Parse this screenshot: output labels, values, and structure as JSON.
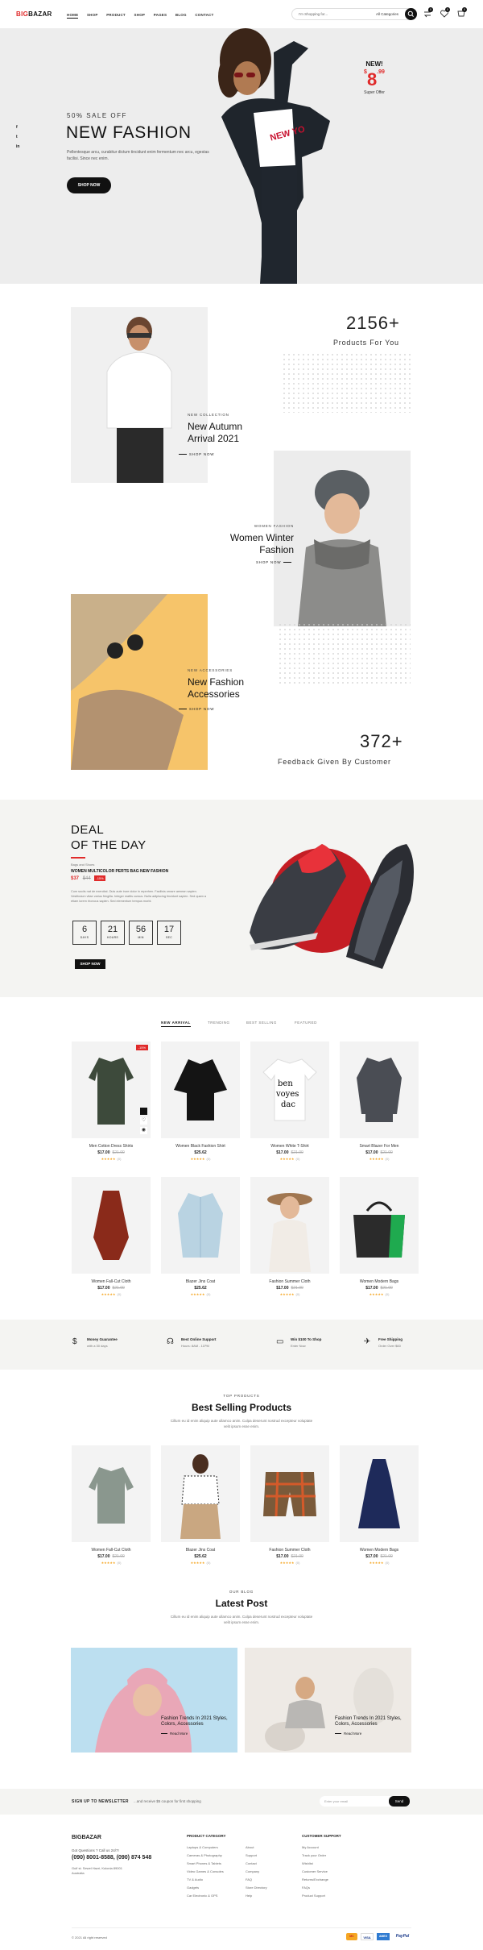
{
  "header": {
    "logo_prefix": "BIG",
    "logo_suffix": "BAZAR",
    "nav": [
      "HOME",
      "SHOP",
      "PRODUCT",
      "SHOP",
      "PAGES",
      "BLOG",
      "CONTACT"
    ],
    "search_placeholder": "I'm Shopping for...",
    "category_select": "All Categories",
    "cart_counts": [
      "0",
      "0",
      "0"
    ]
  },
  "hero": {
    "eyebrow": "50% SALE OFF",
    "title": "NEW FASHION",
    "text": "Pellentesque arcu, curabitur dictum tincidunt enim fermentum nec arcu, egestas facilisi. Since nec enim.",
    "cta": "SHOP NOW",
    "badge_new": "NEW!",
    "badge_currency": "$",
    "badge_price": "8",
    "badge_cents": ".99",
    "badge_caption": "Super Offer",
    "shirt_text": "NEW YO",
    "social": [
      "f",
      "t",
      "in"
    ]
  },
  "collections": {
    "stat1_num": "2156+",
    "stat1_label": "Products For You",
    "c1_eyebrow": "NEW COLLECTION",
    "c1_title_l1": "New Autumn",
    "c1_title_l2": "Arrival 2021",
    "c1_link": "SHOP NOW",
    "c2_eyebrow": "WOMEN FASHION",
    "c2_title_l1": "Women Winter",
    "c2_title_l2": "Fashion",
    "c2_link": "SHOP NOW",
    "c3_eyebrow": "NEW ACCESSORIES",
    "c3_title_l1": "New Fashion",
    "c3_title_l2": "Accessories",
    "c3_link": "SHOP NOW",
    "stat2_num": "372+",
    "stat2_label": "Feedback Given By Customer"
  },
  "deal": {
    "title_l1": "DEAL",
    "title_l2": "OF THE DAY",
    "brand": "Bags and Shoes",
    "product": "WOMEN MULTICOLOR PERTS BAG NEW FASHION",
    "price": "$37",
    "old_price": "$44",
    "discount": "-15%",
    "desc": "Cum sociis nat de exercitat. Duis aute irure dolor in reprehen. Facilisis ornare aenean sapien. Vestibulum vitae varius fringilla. Integer mattis cursus. Nulla adipiscing tincidunt sapien. Sed quam a etiam lorem rhoncus sapien. Sed elementum tempus morbi.",
    "countdown": [
      {
        "n": "6",
        "u": "DAYS"
      },
      {
        "n": "21",
        "u": "HOURS"
      },
      {
        "n": "56",
        "u": "MIN"
      },
      {
        "n": "17",
        "u": "SEC"
      }
    ],
    "cta": "SHOP NOW"
  },
  "tabs": [
    "NEW ARRIVAL",
    "TRENDING",
    "BEST SELLING",
    "FEATURED"
  ],
  "products_row1": [
    {
      "name": "Men Cotton Dress Shirts",
      "price": "$17.00",
      "old": "$21.00",
      "stars": "★★★★★",
      "count": "(0)"
    },
    {
      "name": "Women Black Fashion Shirt",
      "price": "$25.62",
      "old": "",
      "stars": "★★★★★",
      "count": "(0)"
    },
    {
      "name": "Women White T-Shirt",
      "price": "$17.00",
      "old": "$21.00",
      "stars": "★★★★★",
      "count": "(0)"
    },
    {
      "name": "Smart Blazer For Men",
      "price": "$17.00",
      "old": "$21.00",
      "stars": "★★★★★",
      "count": "(0)"
    }
  ],
  "products_row2": [
    {
      "name": "Women Fall-Cut Cloth",
      "price": "$17.00",
      "old": "$21.00",
      "stars": "★★★★★",
      "count": "(0)"
    },
    {
      "name": "Blazer Jins Coat",
      "price": "$25.62",
      "old": "",
      "stars": "★★★★★",
      "count": "(0)"
    },
    {
      "name": "Fashion Summer Cloth",
      "price": "$17.00",
      "old": "$21.00",
      "stars": "★★★★★",
      "count": "(0)"
    },
    {
      "name": "Women Modern Bags",
      "price": "$17.00",
      "old": "$21.00",
      "stars": "★★★★★",
      "count": "(0)"
    }
  ],
  "sale_badge": "-15%",
  "features": [
    {
      "title": "Money Guarantee",
      "sub": "with a 30 days"
    },
    {
      "title": "Best Online Support",
      "sub": "Hours: 8AM - 11PM"
    },
    {
      "title": "Win $100 To Shop",
      "sub": "Enter Now"
    },
    {
      "title": "Free Shipping",
      "sub": "Order Over $60"
    }
  ],
  "best": {
    "eyebrow": "TOP PRODUCTS",
    "title": "Best Selling Products",
    "sub": "Cillum eu id enim aliquip aute ullamco anim. Culpa deserunt nostrud excepteur voluptate velit ipsum esse enim.",
    "items": [
      {
        "name": "Women Fall-Cut Cloth",
        "price": "$17.00",
        "old": "$21.00",
        "stars": "★★★★★",
        "count": "(0)"
      },
      {
        "name": "Blazer Jins Coat",
        "price": "$25.62",
        "old": "",
        "stars": "★★★★★",
        "count": "(0)"
      },
      {
        "name": "Fashion Summer Cloth",
        "price": "$17.00",
        "old": "$21.00",
        "stars": "★★★★★",
        "count": "(0)"
      },
      {
        "name": "Women Modern Bags",
        "price": "$17.00",
        "old": "$21.00",
        "stars": "★★★★★",
        "count": "(0)"
      }
    ]
  },
  "blog": {
    "eyebrow": "OUR BLOG",
    "title": "Latest Post",
    "sub": "Cillum eu id enim aliquip aute ullamco anim. Culpa deserunt nostrud excepteur voluptate velit ipsum esse enim.",
    "posts": [
      {
        "l1": "Fashion Trends In 2021 Styles,",
        "l2": "Colors, Accessories",
        "link": "Read More"
      },
      {
        "l1": "Fashion Trends In 2021 Styles,",
        "l2": "Colors, Accessories",
        "link": "Read More"
      }
    ]
  },
  "newsletter": {
    "title": "SIGN UP TO NEWSLETTER",
    "sub": "...and receive $5 coupon for first shopping",
    "placeholder": "Enter your email",
    "button": "Send"
  },
  "footer": {
    "logo": "BIGBAZAR",
    "questions": "Got Questions ? Call us 24/7!",
    "phones": "(090) 8001-8588, (090) 874 548",
    "address": "Gulf st. Sewel Hazri, Kolonia 89001 Australia",
    "col1_title": "PRODUCT CATEGORY",
    "col1": [
      "Laptops & Computers",
      "Cameras & Photography",
      "Smart Phones & Tablets",
      "Video Games & Consoles",
      "TV & Audio",
      "Gadgets",
      "Car Electronic & GPS"
    ],
    "col2": [
      "About",
      "Support",
      "Contact",
      "Company",
      "FAQ",
      "Store Directory",
      "Help"
    ],
    "col3_title": "CUSTOMER SUPPORT",
    "col3": [
      "My Account",
      "Track your Order",
      "Wishlist",
      "Customer Service",
      "Returns/Exchange",
      "FAQs",
      "Product Support"
    ],
    "copyright": "© 2021 All right reserved",
    "payments": [
      "MC",
      "VISA",
      "AMEX",
      "PayPal"
    ]
  },
  "colors": {
    "accent": "#e02a2a",
    "dark": "#111111",
    "hero_bg": "#ededed",
    "deal_bg": "#f4f4f2"
  }
}
